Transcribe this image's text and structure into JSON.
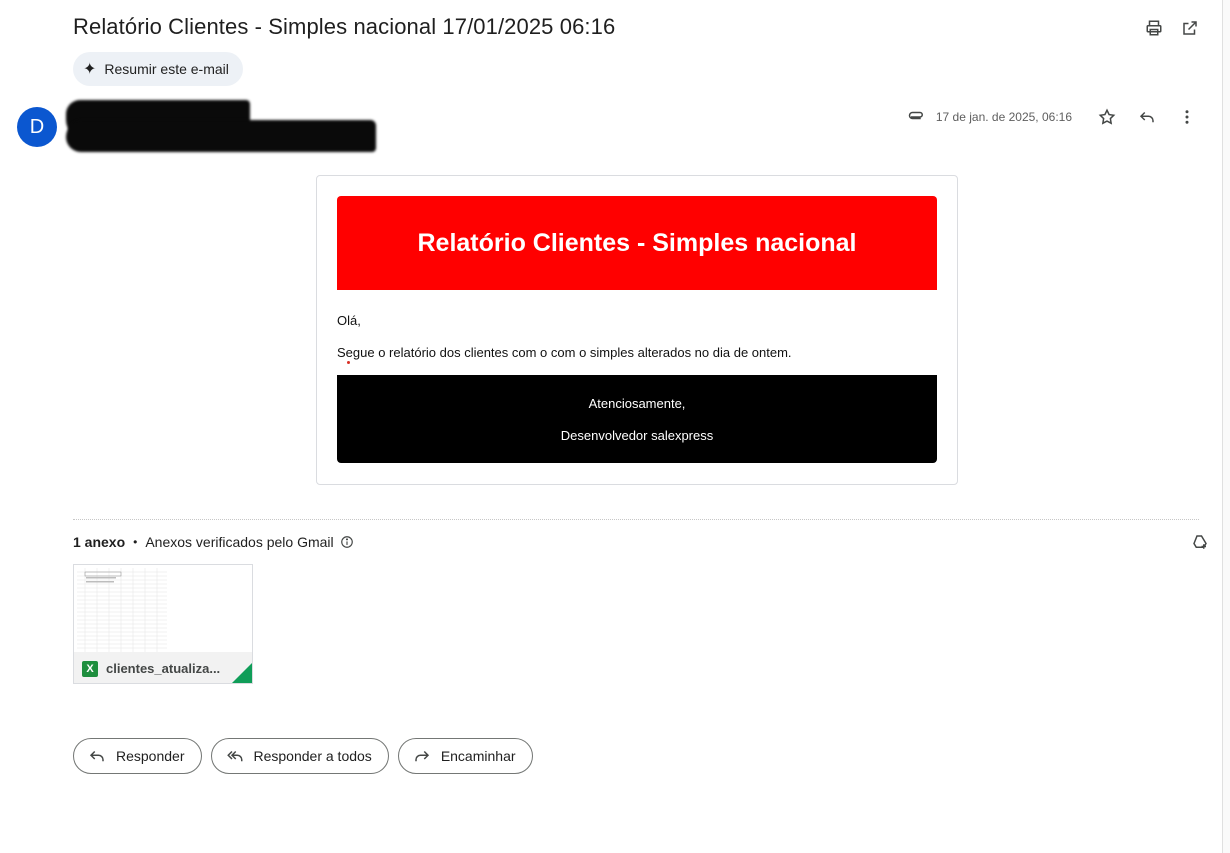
{
  "subject": "Relatório Clientes - Simples nacional 17/01/2025 06:16",
  "summarize_label": "Resumir este e-mail",
  "sender": {
    "avatar_letter": "D"
  },
  "meta": {
    "date": "17 de jan. de 2025, 06:16"
  },
  "email_body": {
    "banner_title": "Relatório Clientes - Simples nacional",
    "greeting": "Olá,",
    "message": "Segue o relatório dos clientes com o com o simples alterados no dia de ontem.",
    "signoff": "Atenciosamente,",
    "signature": "Desenvolvedor salexpress",
    "banner_color": "#ff0000",
    "footer_color": "#000000"
  },
  "attachments": {
    "count_label": "1 anexo",
    "verified_label": "Anexos verificados pelo Gmail",
    "files": [
      {
        "name": "clientes_atualiza...",
        "type_icon": "X"
      }
    ]
  },
  "actions": {
    "reply": "Responder",
    "reply_all": "Responder a todos",
    "forward": "Encaminhar"
  },
  "icons": [
    "print-icon",
    "open-in-new-window-icon",
    "sparkle-icon",
    "paperclip-icon",
    "star-icon",
    "reply-icon",
    "more-vert-icon",
    "info-icon",
    "add-to-drive-icon",
    "reply-all-icon",
    "forward-icon",
    "excel-icon"
  ]
}
